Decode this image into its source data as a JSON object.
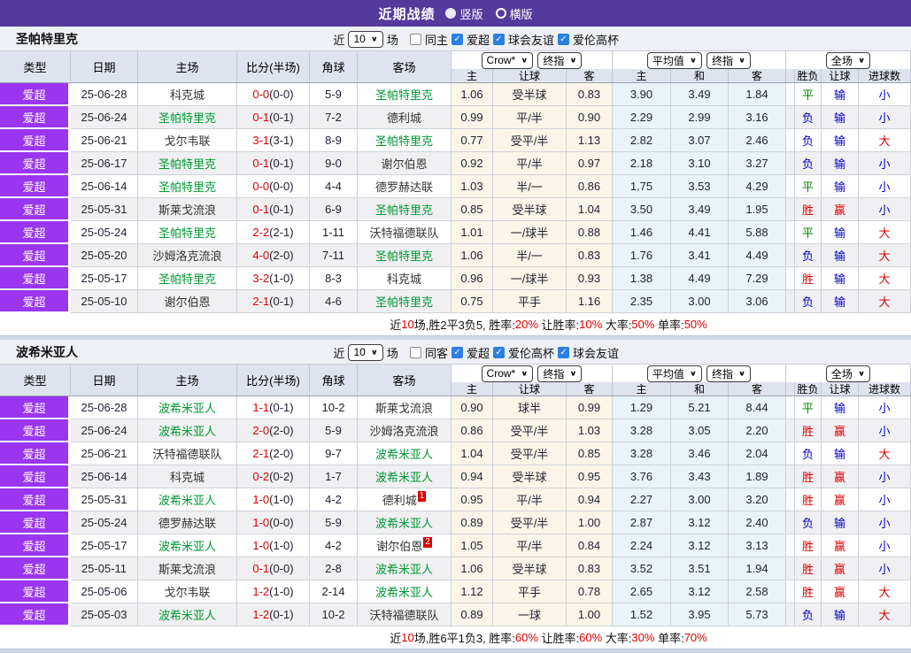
{
  "topbar": {
    "title": "近期战绩",
    "vertical": "竖版",
    "horizontal": "横版"
  },
  "labels": {
    "near": "近",
    "count": "10",
    "games": "场",
    "cols": {
      "type": "类型",
      "date": "日期",
      "home": "主场",
      "score": "比分(半场)",
      "corner": "角球",
      "away": "客场"
    },
    "selects": {
      "crow": "Crow*",
      "final": "终指",
      "avg": "平均值",
      "full": "全场"
    },
    "sub": {
      "home": "主",
      "handicap": "让球",
      "away": "客",
      "draw": "和",
      "result": "胜负",
      "goals": "进球数"
    }
  },
  "sections": [
    {
      "team": "圣帕特里克",
      "same_label": "同主",
      "leagues": [
        "爱超",
        "球会友谊",
        "爱伦高杯"
      ],
      "rows": [
        {
          "league": "爱超",
          "date": "25-06-28",
          "home": "科克城",
          "home_badge": "",
          "score": "0-0",
          "half": "(0-0)",
          "corner": "5-9",
          "away": "圣帕特里克",
          "away_badge": "",
          "odds": [
            "1.06",
            "受半球",
            "0.83"
          ],
          "avg": [
            "3.90",
            "3.49",
            "1.84"
          ],
          "result": "平",
          "cover": "输",
          "goals": "小"
        },
        {
          "league": "爱超",
          "date": "25-06-24",
          "home": "圣帕特里克",
          "home_badge": "",
          "score": "0-1",
          "half": "(0-1)",
          "corner": "7-2",
          "away": "德利城",
          "away_badge": "",
          "odds": [
            "0.99",
            "平/半",
            "0.90"
          ],
          "avg": [
            "2.29",
            "2.99",
            "3.16"
          ],
          "result": "负",
          "cover": "输",
          "goals": "小"
        },
        {
          "league": "爱超",
          "date": "25-06-21",
          "home": "戈尔韦联",
          "home_badge": "",
          "score": "3-1",
          "half": "(3-1)",
          "corner": "8-9",
          "away": "圣帕特里克",
          "away_badge": "",
          "odds": [
            "0.77",
            "受平/半",
            "1.13"
          ],
          "avg": [
            "2.82",
            "3.07",
            "2.46"
          ],
          "result": "负",
          "cover": "输",
          "goals": "大"
        },
        {
          "league": "爱超",
          "date": "25-06-17",
          "home": "圣帕特里克",
          "home_badge": "",
          "score": "0-1",
          "half": "(0-1)",
          "corner": "9-0",
          "away": "谢尔伯恩",
          "away_badge": "",
          "odds": [
            "0.92",
            "平/半",
            "0.97"
          ],
          "avg": [
            "2.18",
            "3.10",
            "3.27"
          ],
          "result": "负",
          "cover": "输",
          "goals": "小"
        },
        {
          "league": "爱超",
          "date": "25-06-14",
          "home": "圣帕特里克",
          "home_badge": "",
          "score": "0-0",
          "half": "(0-0)",
          "corner": "4-4",
          "away": "德罗赫达联",
          "away_badge": "",
          "odds": [
            "1.03",
            "半/一",
            "0.86"
          ],
          "avg": [
            "1.75",
            "3.53",
            "4.29"
          ],
          "result": "平",
          "cover": "输",
          "goals": "小"
        },
        {
          "league": "爱超",
          "date": "25-05-31",
          "home": "斯莱戈流浪",
          "home_badge": "",
          "score": "0-1",
          "half": "(0-1)",
          "corner": "6-9",
          "away": "圣帕特里克",
          "away_badge": "",
          "odds": [
            "0.85",
            "受半球",
            "1.04"
          ],
          "avg": [
            "3.50",
            "3.49",
            "1.95"
          ],
          "result": "胜",
          "cover": "赢",
          "goals": "小"
        },
        {
          "league": "爱超",
          "date": "25-05-24",
          "home": "圣帕特里克",
          "home_badge": "",
          "score": "2-2",
          "half": "(2-1)",
          "corner": "1-11",
          "away": "沃特福德联队",
          "away_badge": "",
          "odds": [
            "1.01",
            "一/球半",
            "0.88"
          ],
          "avg": [
            "1.46",
            "4.41",
            "5.88"
          ],
          "result": "平",
          "cover": "输",
          "goals": "大"
        },
        {
          "league": "爱超",
          "date": "25-05-20",
          "home": "沙姆洛克流浪",
          "home_badge": "",
          "score": "4-0",
          "half": "(2-0)",
          "corner": "7-11",
          "away": "圣帕特里克",
          "away_badge": "",
          "odds": [
            "1.06",
            "半/一",
            "0.83"
          ],
          "avg": [
            "1.76",
            "3.41",
            "4.49"
          ],
          "result": "负",
          "cover": "输",
          "goals": "大"
        },
        {
          "league": "爱超",
          "date": "25-05-17",
          "home": "圣帕特里克",
          "home_badge": "",
          "score": "3-2",
          "half": "(1-0)",
          "corner": "8-3",
          "away": "科克城",
          "away_badge": "",
          "odds": [
            "0.96",
            "一/球半",
            "0.93"
          ],
          "avg": [
            "1.38",
            "4.49",
            "7.29"
          ],
          "result": "胜",
          "cover": "输",
          "goals": "大"
        },
        {
          "league": "爱超",
          "date": "25-05-10",
          "home": "谢尔伯恩",
          "home_badge": "",
          "score": "2-1",
          "half": "(0-1)",
          "corner": "4-6",
          "away": "圣帕特里克",
          "away_badge": "",
          "odds": [
            "0.75",
            "平手",
            "1.16"
          ],
          "avg": [
            "2.35",
            "3.00",
            "3.06"
          ],
          "result": "负",
          "cover": "输",
          "goals": "大"
        }
      ],
      "summary": {
        "t1": "近",
        "v1": "10",
        "t2": "场,胜2平3负5, 胜率:",
        "v2": "20%",
        "t3": " 让胜率:",
        "v3": "10%",
        "t4": " 大率:",
        "v4": "50%",
        "t5": " 单率:",
        "v5": "50%"
      }
    },
    {
      "team": "波希米亚人",
      "same_label": "同客",
      "leagues": [
        "爱超",
        "爱伦高杯",
        "球会友谊"
      ],
      "rows": [
        {
          "league": "爱超",
          "date": "25-06-28",
          "home": "波希米亚人",
          "home_badge": "",
          "score": "1-1",
          "half": "(0-1)",
          "corner": "10-2",
          "away": "斯莱戈流浪",
          "away_badge": "",
          "odds": [
            "0.90",
            "球半",
            "0.99"
          ],
          "avg": [
            "1.29",
            "5.21",
            "8.44"
          ],
          "result": "平",
          "cover": "输",
          "goals": "小"
        },
        {
          "league": "爱超",
          "date": "25-06-24",
          "home": "波希米亚人",
          "home_badge": "",
          "score": "2-0",
          "half": "(2-0)",
          "corner": "5-9",
          "away": "沙姆洛克流浪",
          "away_badge": "",
          "odds": [
            "0.86",
            "受平/半",
            "1.03"
          ],
          "avg": [
            "3.28",
            "3.05",
            "2.20"
          ],
          "result": "胜",
          "cover": "赢",
          "goals": "小"
        },
        {
          "league": "爱超",
          "date": "25-06-21",
          "home": "沃特福德联队",
          "home_badge": "",
          "score": "2-1",
          "half": "(2-0)",
          "corner": "9-7",
          "away": "波希米亚人",
          "away_badge": "",
          "odds": [
            "1.04",
            "受平/半",
            "0.85"
          ],
          "avg": [
            "3.28",
            "3.46",
            "2.04"
          ],
          "result": "负",
          "cover": "输",
          "goals": "大"
        },
        {
          "league": "爱超",
          "date": "25-06-14",
          "home": "科克城",
          "home_badge": "",
          "score": "0-2",
          "half": "(0-2)",
          "corner": "1-7",
          "away": "波希米亚人",
          "away_badge": "",
          "odds": [
            "0.94",
            "受半球",
            "0.95"
          ],
          "avg": [
            "3.76",
            "3.43",
            "1.89"
          ],
          "result": "胜",
          "cover": "赢",
          "goals": "小"
        },
        {
          "league": "爱超",
          "date": "25-05-31",
          "home": "波希米亚人",
          "home_badge": "",
          "score": "1-0",
          "half": "(1-0)",
          "corner": "4-2",
          "away": "德利城",
          "away_badge": "1",
          "odds": [
            "0.95",
            "平/半",
            "0.94"
          ],
          "avg": [
            "2.27",
            "3.00",
            "3.20"
          ],
          "result": "胜",
          "cover": "赢",
          "goals": "小"
        },
        {
          "league": "爱超",
          "date": "25-05-24",
          "home": "德罗赫达联",
          "home_badge": "",
          "score": "1-0",
          "half": "(0-0)",
          "corner": "5-9",
          "away": "波希米亚人",
          "away_badge": "",
          "odds": [
            "0.89",
            "受平/半",
            "1.00"
          ],
          "avg": [
            "2.87",
            "3.12",
            "2.40"
          ],
          "result": "负",
          "cover": "输",
          "goals": "小"
        },
        {
          "league": "爱超",
          "date": "25-05-17",
          "home": "波希米亚人",
          "home_badge": "",
          "score": "1-0",
          "half": "(1-0)",
          "corner": "4-2",
          "away": "谢尔伯恩",
          "away_badge": "2",
          "odds": [
            "1.05",
            "平/半",
            "0.84"
          ],
          "avg": [
            "2.24",
            "3.12",
            "3.13"
          ],
          "result": "胜",
          "cover": "赢",
          "goals": "小"
        },
        {
          "league": "爱超",
          "date": "25-05-11",
          "home": "斯莱戈流浪",
          "home_badge": "",
          "score": "0-1",
          "half": "(0-0)",
          "corner": "2-8",
          "away": "波希米亚人",
          "away_badge": "",
          "odds": [
            "1.06",
            "受半球",
            "0.83"
          ],
          "avg": [
            "3.52",
            "3.51",
            "1.94"
          ],
          "result": "胜",
          "cover": "赢",
          "goals": "小"
        },
        {
          "league": "爱超",
          "date": "25-05-06",
          "home": "戈尔韦联",
          "home_badge": "",
          "score": "1-2",
          "half": "(1-0)",
          "corner": "2-14",
          "away": "波希米亚人",
          "away_badge": "",
          "odds": [
            "1.12",
            "平手",
            "0.78"
          ],
          "avg": [
            "2.65",
            "3.12",
            "2.58"
          ],
          "result": "胜",
          "cover": "赢",
          "goals": "大"
        },
        {
          "league": "爱超",
          "date": "25-05-03",
          "home": "波希米亚人",
          "home_badge": "",
          "score": "1-2",
          "half": "(0-1)",
          "corner": "10-2",
          "away": "沃特福德联队",
          "away_badge": "",
          "odds": [
            "0.89",
            "一球",
            "1.00"
          ],
          "avg": [
            "1.52",
            "3.95",
            "5.73"
          ],
          "result": "负",
          "cover": "输",
          "goals": "大"
        }
      ],
      "summary": {
        "t1": "近",
        "v1": "10",
        "t2": "场,胜6平1负3, 胜率:",
        "v2": "60%",
        "t3": " 让胜率:",
        "v3": "60%",
        "t4": " 大率:",
        "v4": "30%",
        "t5": " 单率:",
        "v5": "70%"
      }
    }
  ]
}
